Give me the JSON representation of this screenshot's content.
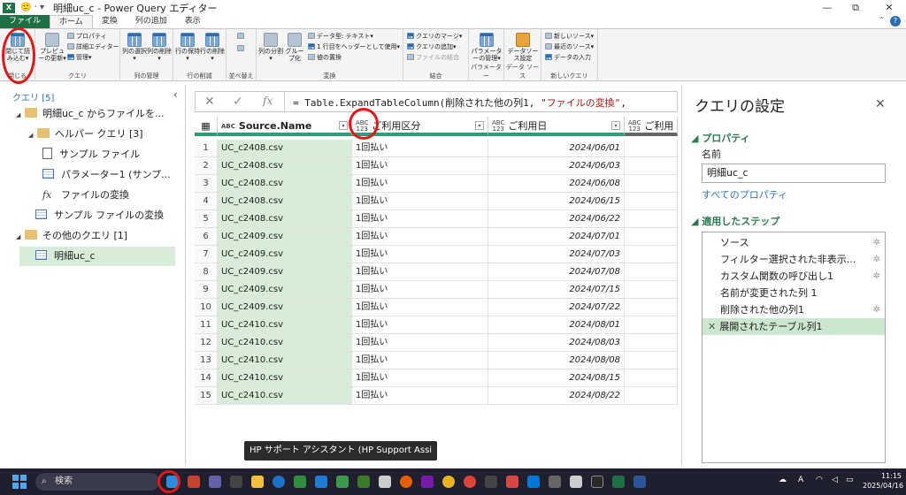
{
  "window": {
    "title": "明細uc_c - Power Query エディター",
    "qa_symbol": "🙂 · ▾",
    "controls": [
      "⧉",
      "✕"
    ],
    "restore_label": "—"
  },
  "ribbon_tabs": [
    "ファイル",
    "ホーム",
    "変換",
    "列の追加",
    "表示"
  ],
  "ribbon": {
    "close_load": "閉じて読み込む▾",
    "close_group": "閉じる",
    "preview_refresh": "プレビューの更新▾",
    "properties": "プロパティ",
    "advanced_editor": "詳細エディター",
    "manage": "管理▾",
    "query_group": "クエリ",
    "choose_columns": "列の選択▾",
    "remove_columns": "列の削除▾",
    "manage_columns_group": "列の管理",
    "keep_rows": "行の保持▾",
    "remove_rows": "行の削除▾",
    "reduce_rows_group": "行の削減",
    "sort_group": "並べ替え",
    "split_column": "列の分割▾",
    "group_by": "グループ化",
    "data_type": "データ型: テキスト▾",
    "first_row_header": "1 行目をヘッダーとして使用▾",
    "replace_values": "値の置換",
    "transform_group": "変換",
    "merge_queries": "クエリのマージ▾",
    "append_queries": "クエリの追加▾",
    "combine_files": "ファイルの結合",
    "combine_group": "結合",
    "manage_parameters": "パラメーターの管理▾",
    "parameters_group": "パラメーター",
    "data_source_settings": "データソース設定",
    "data_sources_group": "データ ソース",
    "new_source": "新しいソース▾",
    "recent_sources": "最近のソース▾",
    "enter_data": "データの入力",
    "new_query_group": "新しいクエリ"
  },
  "queries_pane": {
    "header": "クエリ [5]",
    "items": [
      {
        "label": "明細uc_c からファイルを...",
        "kind": "folder",
        "tri": "◢"
      },
      {
        "label": "ヘルパー クエリ [3]",
        "kind": "folder",
        "tri": "◢"
      },
      {
        "label": "サンプル ファイル",
        "kind": "doc"
      },
      {
        "label": "パラメーター1 (サンプ...",
        "kind": "table"
      },
      {
        "label": "ファイルの変換",
        "kind": "fx"
      },
      {
        "label": "サンプル ファイルの変換",
        "kind": "table"
      },
      {
        "label": "その他のクエリ [1]",
        "kind": "folder",
        "tri": "◢"
      },
      {
        "label": "明細uc_c",
        "kind": "table",
        "selected": true
      }
    ]
  },
  "formula": {
    "text_prefix": "= Table.ExpandTableColumn(削除された他の列1, ",
    "text_string": "\"ファイルの変換\"",
    "text_suffix": ",",
    "fx": "fx"
  },
  "grid": {
    "columns": [
      {
        "type": "ABC",
        "name": "Source.Name"
      },
      {
        "type": "ABC\n123",
        "name": "ご利用区分"
      },
      {
        "type": "ABC\n123",
        "name": "ご利用日"
      },
      {
        "type": "ABC\n123",
        "name": "ご利用"
      }
    ],
    "rows": [
      [
        "1",
        "UC_c2408.csv",
        "1回払い",
        "2024/06/01"
      ],
      [
        "2",
        "UC_c2408.csv",
        "1回払い",
        "2024/06/03"
      ],
      [
        "3",
        "UC_c2408.csv",
        "1回払い",
        "2024/06/08"
      ],
      [
        "4",
        "UC_c2408.csv",
        "1回払い",
        "2024/06/15"
      ],
      [
        "5",
        "UC_c2408.csv",
        "1回払い",
        "2024/06/22"
      ],
      [
        "6",
        "UC_c2409.csv",
        "1回払い",
        "2024/07/01"
      ],
      [
        "7",
        "UC_c2409.csv",
        "1回払い",
        "2024/07/03"
      ],
      [
        "8",
        "UC_c2409.csv",
        "1回払い",
        "2024/07/08"
      ],
      [
        "9",
        "UC_c2409.csv",
        "1回払い",
        "2024/07/15"
      ],
      [
        "10",
        "UC_c2409.csv",
        "1回払い",
        "2024/07/22"
      ],
      [
        "11",
        "UC_c2410.csv",
        "1回払い",
        "2024/08/01"
      ],
      [
        "12",
        "UC_c2410.csv",
        "1回払い",
        "2024/08/03"
      ],
      [
        "13",
        "UC_c2410.csv",
        "1回払い",
        "2024/08/08"
      ],
      [
        "14",
        "UC_c2410.csv",
        "1回払い",
        "2024/08/15"
      ],
      [
        "15",
        "UC_c2410.csv",
        "1回払い",
        "2024/08/22"
      ]
    ]
  },
  "settings": {
    "title": "クエリの設定",
    "properties_header": "◢ プロパティ",
    "name_label": "名前",
    "name_value": "明細uc_c",
    "all_properties": "すべてのプロパティ",
    "steps_header": "◢ 適用したステップ",
    "steps": [
      {
        "label": "ソース",
        "gear": true
      },
      {
        "label": "フィルター選択された非表示...",
        "gear": true
      },
      {
        "label": "カスタム関数の呼び出し1",
        "gear": true
      },
      {
        "label": "名前が変更された列 1",
        "gear": false
      },
      {
        "label": "削除された他の列1",
        "gear": true
      },
      {
        "label": "展開されたテーブル列1",
        "gear": false,
        "active": true
      }
    ]
  },
  "tooltip": "HP サポート アシスタント (HP Support Assi",
  "taskbar": {
    "search_placeholder": "検索",
    "time": "11:15",
    "date": "2025/04/16",
    "ime": "A"
  },
  "colors": {
    "accent_green": "#2d9d78",
    "excel_green": "#1e7145",
    "highlight_red": "#e01818",
    "link_blue": "#2e75b6"
  }
}
